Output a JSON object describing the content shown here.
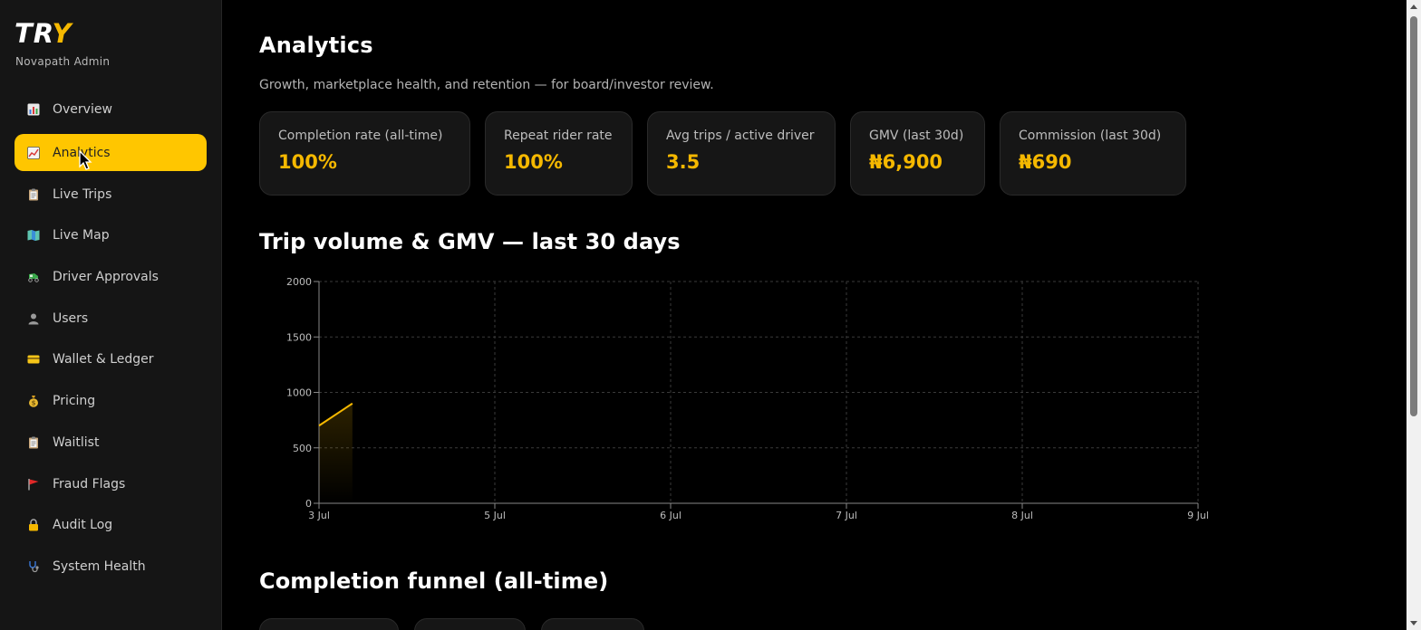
{
  "brand": {
    "logo_text": "TRY",
    "subtitle": "Novapath Admin",
    "accent_color": "#f5b800"
  },
  "sidebar": {
    "active": "Analytics",
    "items": [
      {
        "label": "Overview",
        "icon": "bar-chart-icon"
      },
      {
        "label": "Analytics",
        "icon": "trend-chart-icon"
      },
      {
        "label": "Live Trips",
        "icon": "clipboard-icon"
      },
      {
        "label": "Live Map",
        "icon": "map-icon"
      },
      {
        "label": "Driver Approvals",
        "icon": "rickshaw-icon"
      },
      {
        "label": "Users",
        "icon": "user-icon"
      },
      {
        "label": "Wallet & Ledger",
        "icon": "card-icon"
      },
      {
        "label": "Pricing",
        "icon": "money-bag-icon"
      },
      {
        "label": "Waitlist",
        "icon": "clipboard-icon"
      },
      {
        "label": "Fraud Flags",
        "icon": "flag-icon"
      },
      {
        "label": "Audit Log",
        "icon": "lock-icon"
      },
      {
        "label": "System Health",
        "icon": "stethoscope-icon"
      }
    ]
  },
  "page": {
    "title": "Analytics",
    "description": "Growth, marketplace health, and retention — for board/investor review."
  },
  "kpis": [
    {
      "label": "Completion rate (all-time)",
      "value": "100%"
    },
    {
      "label": "Repeat rider rate",
      "value": "100%"
    },
    {
      "label": "Avg trips / active driver",
      "value": "3.5"
    },
    {
      "label": "GMV (last 30d)",
      "value": "₦6,900"
    },
    {
      "label": "Commission (last 30d)",
      "value": "₦690"
    }
  ],
  "sections": {
    "trip_volume_title": "Trip volume & GMV — last 30 days",
    "funnel_title": "Completion funnel (all-time)"
  },
  "chart_data": {
    "type": "area",
    "x_ticks": [
      "3 Jul",
      "5 Jul",
      "6 Jul",
      "7 Jul",
      "8 Jul",
      "9 Jul"
    ],
    "y_ticks": [
      0,
      500,
      1000,
      1500,
      2000
    ],
    "ylim": [
      0,
      2000
    ],
    "grid": true,
    "series": [
      {
        "values": [
          {
            "x": "3 Jul",
            "y": 700
          },
          {
            "x": "3 Jul",
            "y": 900
          }
        ],
        "x_fraction": [
          0,
          0.19
        ],
        "color": "#f5b800"
      }
    ]
  }
}
